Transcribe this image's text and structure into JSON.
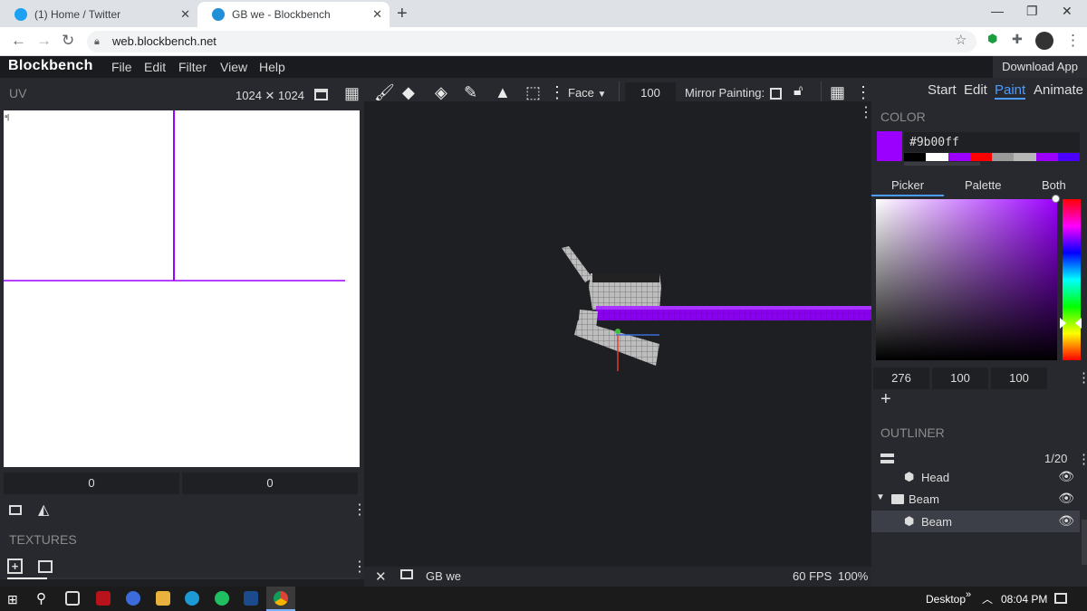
{
  "browser": {
    "tabs": [
      {
        "title": "(1) Home / Twitter",
        "favicon": "twitter-icon"
      },
      {
        "title": "GB we - Blockbench",
        "favicon": "blockbench-icon"
      }
    ],
    "url": "web.blockbench.net"
  },
  "app": {
    "name": "Blockbench",
    "menu": [
      "File",
      "Edit",
      "Filter",
      "View",
      "Help"
    ],
    "download_label": "Download App"
  },
  "toolbar": {
    "select_mode": "Face",
    "brush_size": "100",
    "mirror_label": "Mirror Painting:"
  },
  "uv": {
    "label": "UV",
    "size": "1024 ✕ 1024",
    "field_x": "0",
    "field_y": "0"
  },
  "textures": {
    "label": "TEXTURES"
  },
  "viewport": {
    "model_name": "GB we",
    "fps": "60 FPS",
    "zoom": "100%"
  },
  "modes": [
    "Start",
    "Edit",
    "Paint",
    "Animate"
  ],
  "active_mode": "Paint",
  "color": {
    "label": "COLOR",
    "hex": "#9b00ff",
    "tabs": [
      "Picker",
      "Palette",
      "Both"
    ],
    "active_tab": "Picker",
    "h": "276",
    "s": "100",
    "v": "100",
    "palette": [
      "#000000",
      "#ffffff",
      "#9b00ff",
      "#ff0000",
      "#9a9a9a",
      "#b7b7b7",
      "#9b00ff",
      "#4b00ff"
    ]
  },
  "outliner": {
    "label": "OUTLINER",
    "count": "1/20",
    "items": [
      {
        "name": "Head",
        "type": "cube"
      },
      {
        "name": "Beam",
        "type": "folder"
      },
      {
        "name": "Beam",
        "type": "cube"
      }
    ]
  },
  "taskbar": {
    "desktop_label": "Desktop",
    "time": "08:04 PM"
  }
}
